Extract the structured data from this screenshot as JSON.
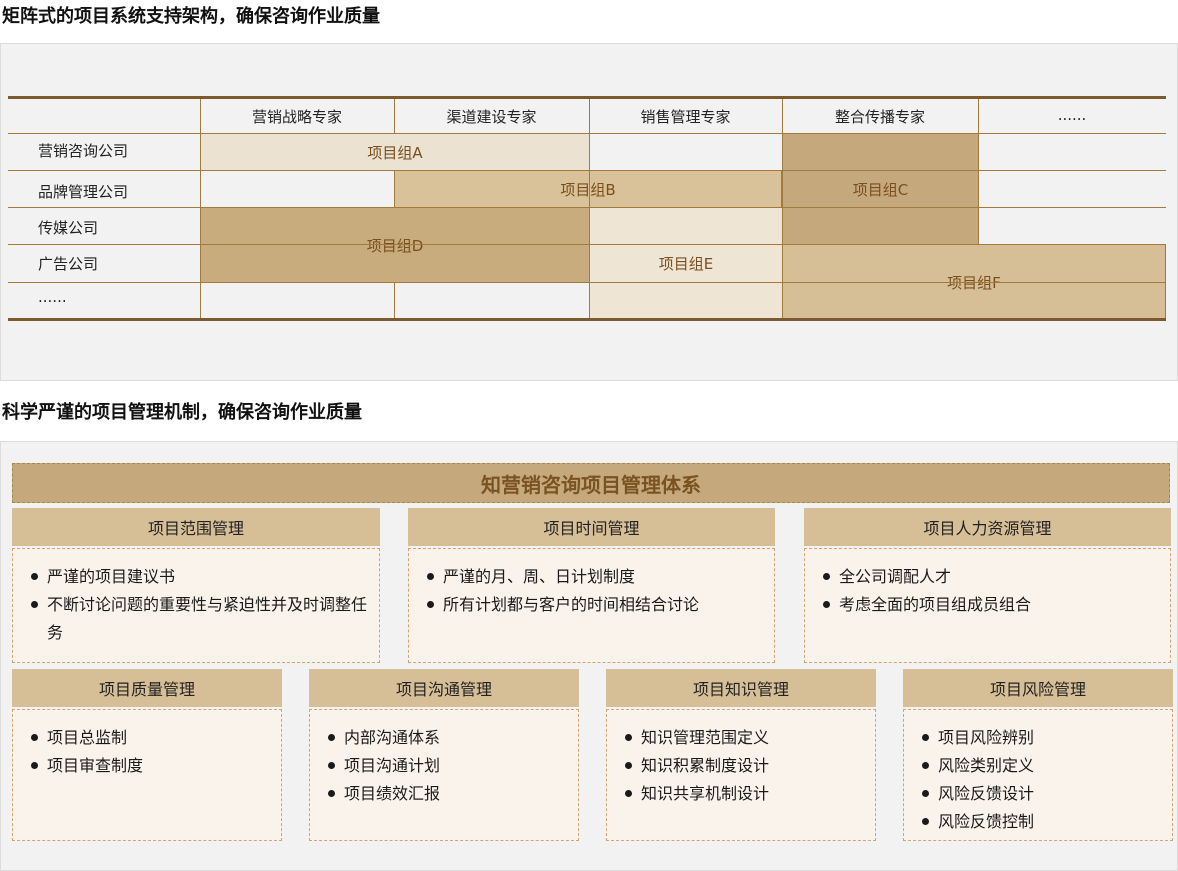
{
  "section1": {
    "title": "矩阵式的项目系统支持架构，确保咨询作业质量",
    "columns": [
      "营销战略专家",
      "渠道建设专家",
      "销售管理专家",
      "整合传播专家",
      "......"
    ],
    "rows": [
      "营销咨询公司",
      "品牌管理公司",
      "传媒公司",
      "广告公司",
      "......"
    ],
    "groups": {
      "A": "项目组A",
      "B": "项目组B",
      "C": "项目组C",
      "D": "项目组D",
      "E": "项目组E",
      "F": "项目组F"
    },
    "colors": {
      "A": "#ece2d1",
      "B": "#d9c199",
      "C": "#c5a97c",
      "D": "#c8ac7e",
      "E": "#efe5d5",
      "F": "#d6bf97"
    }
  },
  "section2": {
    "title": "科学严谨的项目管理机制，确保咨询作业质量",
    "banner": "知营销咨询项目管理体系",
    "cards": [
      {
        "title": "项目范围管理",
        "items": [
          "严谨的项目建议书",
          "不断讨论问题的重要性与紧迫性并及时调整任务"
        ]
      },
      {
        "title": "项目时间管理",
        "items": [
          "严谨的月、周、日计划制度",
          "所有计划都与客户的时间相结合讨论"
        ]
      },
      {
        "title": "项目人力资源管理",
        "items": [
          "全公司调配人才",
          "考虑全面的项目组成员组合"
        ]
      },
      {
        "title": "项目质量管理",
        "items": [
          "项目总监制",
          "项目审查制度"
        ]
      },
      {
        "title": "项目沟通管理",
        "items": [
          "内部沟通体系",
          "项目沟通计划",
          "项目绩效汇报"
        ]
      },
      {
        "title": "项目知识管理",
        "items": [
          "知识管理范围定义",
          "知识积累制度设计",
          "知识共享机制设计"
        ]
      },
      {
        "title": "项目风险管理",
        "items": [
          "项目风险辨别",
          "风险类别定义",
          "风险反馈设计",
          "风险反馈控制"
        ]
      }
    ]
  }
}
